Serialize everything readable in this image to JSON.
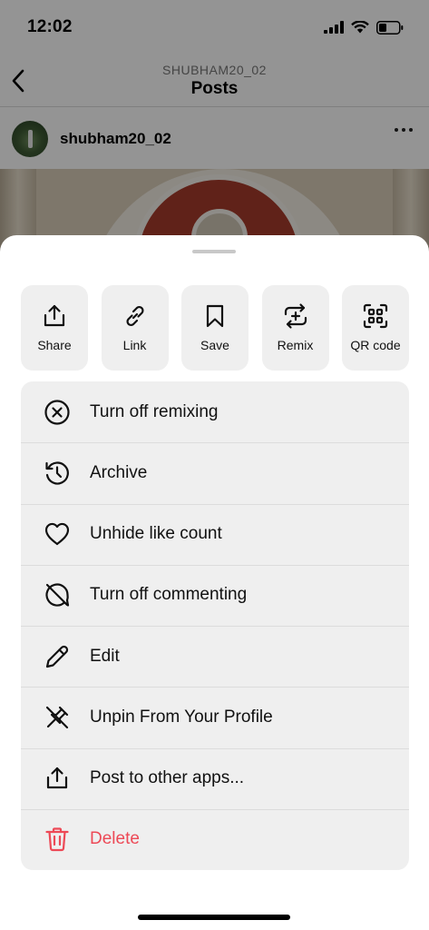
{
  "status_bar": {
    "time": "12:02"
  },
  "header": {
    "subtitle": "SHUBHAM20_02",
    "title": "Posts"
  },
  "post": {
    "username": "shubham20_02"
  },
  "share_actions": [
    {
      "label": "Share",
      "icon": "share-icon"
    },
    {
      "label": "Link",
      "icon": "link-icon"
    },
    {
      "label": "Save",
      "icon": "bookmark-icon"
    },
    {
      "label": "Remix",
      "icon": "remix-icon"
    },
    {
      "label": "QR code",
      "icon": "qr-code-icon"
    }
  ],
  "menu_items": [
    {
      "label": "Turn off remixing",
      "icon": "circle-x-icon"
    },
    {
      "label": "Archive",
      "icon": "archive-history-icon"
    },
    {
      "label": "Unhide like count",
      "icon": "heart-icon"
    },
    {
      "label": "Turn off commenting",
      "icon": "comment-off-icon"
    },
    {
      "label": "Edit",
      "icon": "pencil-icon"
    },
    {
      "label": "Unpin From Your Profile",
      "icon": "unpin-icon"
    },
    {
      "label": "Post to other apps...",
      "icon": "share-icon"
    },
    {
      "label": "Delete",
      "icon": "trash-icon",
      "color": "#ed4956"
    }
  ],
  "colors": {
    "danger": "#ed4956",
    "sheet_button_bg": "#efefef"
  }
}
